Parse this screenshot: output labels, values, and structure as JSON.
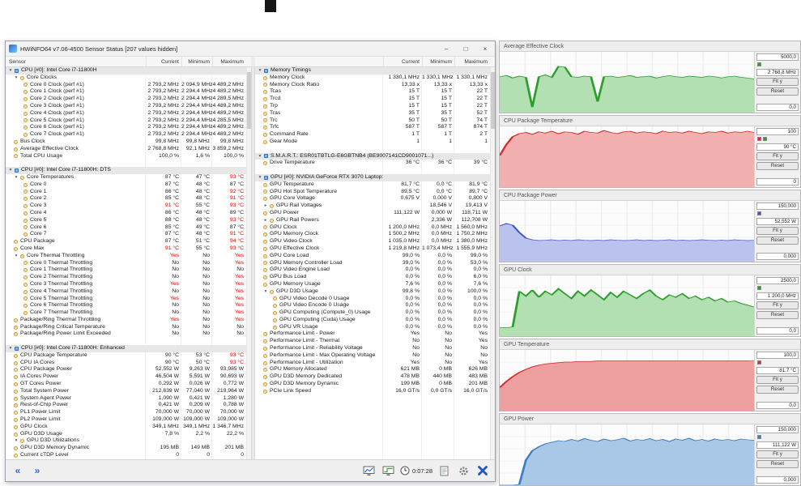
{
  "window": {
    "title": "HWiNFO64 v7.06-4500 Sensor Status [207 values hidden]",
    "controls": {
      "minimize": "–",
      "maximize": "□",
      "close": "×"
    }
  },
  "header": {
    "sensor": "Sensor",
    "current": "Current",
    "minimum": "Minimum",
    "maximum": "Maximum"
  },
  "toolbar": {
    "time": "0:07:28",
    "shrink_icon": "«",
    "expand_icon": "»"
  },
  "graph_buttons": {
    "fit": "Fit y",
    "reset": "Reset"
  },
  "left_rows": [
    {
      "t": "s",
      "l": "CPU [#0]: Intel Core i7-11800H"
    },
    {
      "t": "g",
      "i": 1,
      "l": "Core Clocks"
    },
    {
      "t": "i",
      "i": 2,
      "l": "Core 0 Clock (perf #1)",
      "c": "2 793,2 MHz",
      "m": "2 094,9 MHz",
      "x": "4 489,2 MHz"
    },
    {
      "t": "i",
      "i": 2,
      "l": "Core 1 Clock (perf #1)",
      "c": "2 793,2 MHz",
      "m": "2 294,4 MHz",
      "x": "4 489,2 MHz"
    },
    {
      "t": "i",
      "i": 2,
      "l": "Core 2 Clock (perf #1)",
      "c": "2 793,2 MHz",
      "m": "2 294,4 MHz",
      "x": "4 289,5 MHz"
    },
    {
      "t": "i",
      "i": 2,
      "l": "Core 3 Clock (perf #1)",
      "c": "2 793,2 MHz",
      "m": "2 294,4 MHz",
      "x": "4 489,2 MHz"
    },
    {
      "t": "i",
      "i": 2,
      "l": "Core 4 Clock (perf #1)",
      "c": "2 793,2 MHz",
      "m": "2 294,4 MHz",
      "x": "4 489,2 MHz"
    },
    {
      "t": "i",
      "i": 2,
      "l": "Core 5 Clock (perf #1)",
      "c": "2 793,2 MHz",
      "m": "2 294,4 MHz",
      "x": "4 285,5 MHz"
    },
    {
      "t": "i",
      "i": 2,
      "l": "Core 6 Clock (perf #1)",
      "c": "2 793,2 MHz",
      "m": "2 294,4 MHz",
      "x": "4 489,2 MHz"
    },
    {
      "t": "i",
      "i": 2,
      "l": "Core 7 Clock (perf #1)",
      "c": "2 793,2 MHz",
      "m": "2 294,4 MHz",
      "x": "4 489,2 MHz"
    },
    {
      "t": "i",
      "i": 1,
      "l": "Bus Clock",
      "c": "99,8 MHz",
      "m": "99,8 MHz",
      "x": "99,8 MHz"
    },
    {
      "t": "i",
      "i": 1,
      "l": "Average Effective Clock",
      "c": "2 768,8 MHz",
      "m": "92,1 MHz",
      "x": "3 859,2 MHz"
    },
    {
      "t": "i",
      "i": 1,
      "l": "Total CPU Usage",
      "c": "100,0 %",
      "m": "1,6 %",
      "x": "100,0 %"
    },
    {
      "t": "sp"
    },
    {
      "t": "s",
      "l": "CPU [#0]: Intel Core i7-11800H: DTS"
    },
    {
      "t": "g",
      "i": 1,
      "l": "Core Temperatures",
      "c": "87 °C",
      "m": "47 °C",
      "x": "93 °C",
      "r": "x"
    },
    {
      "t": "i",
      "i": 2,
      "l": "Core 0",
      "c": "87 °C",
      "m": "48 °C",
      "x": "87 °C"
    },
    {
      "t": "i",
      "i": 2,
      "l": "Core 1",
      "c": "86 °C",
      "m": "48 °C",
      "x": "92 °C",
      "r": "x"
    },
    {
      "t": "i",
      "i": 2,
      "l": "Core 2",
      "c": "85 °C",
      "m": "48 °C",
      "x": "91 °C",
      "r": "x"
    },
    {
      "t": "i",
      "i": 2,
      "l": "Core 3",
      "c": "91 °C",
      "m": "55 °C",
      "x": "93 °C",
      "r": "cx"
    },
    {
      "t": "i",
      "i": 2,
      "l": "Core 4",
      "c": "86 °C",
      "m": "48 °C",
      "x": "89 °C"
    },
    {
      "t": "i",
      "i": 2,
      "l": "Core 5",
      "c": "88 °C",
      "m": "48 °C",
      "x": "93 °C",
      "r": "x"
    },
    {
      "t": "i",
      "i": 2,
      "l": "Core 6",
      "c": "85 °C",
      "m": "49 °C",
      "x": "87 °C"
    },
    {
      "t": "i",
      "i": 2,
      "l": "Core 7",
      "c": "87 °C",
      "m": "48 °C",
      "x": "91 °C",
      "r": "x"
    },
    {
      "t": "i",
      "i": 1,
      "l": "CPU Package",
      "c": "87 °C",
      "m": "51 °C",
      "x": "94 °C",
      "r": "x"
    },
    {
      "t": "i",
      "i": 1,
      "l": "Core Max",
      "c": "91 °C",
      "m": "55 °C",
      "x": "93 °C",
      "r": "cx"
    },
    {
      "t": "g",
      "i": 1,
      "l": "Core Thermal Throttling",
      "c": "Yes",
      "m": "No",
      "x": "Yes",
      "r": "cx"
    },
    {
      "t": "i",
      "i": 2,
      "l": "Core 0 Thermal Throttling",
      "c": "No",
      "m": "No",
      "x": "Yes",
      "r": "x"
    },
    {
      "t": "i",
      "i": 2,
      "l": "Core 1 Thermal Throttling",
      "c": "No",
      "m": "No",
      "x": "No"
    },
    {
      "t": "i",
      "i": 2,
      "l": "Core 2 Thermal Throttling",
      "c": "No",
      "m": "No",
      "x": "Yes",
      "r": "x"
    },
    {
      "t": "i",
      "i": 2,
      "l": "Core 3 Thermal Throttling",
      "c": "Yes",
      "m": "No",
      "x": "Yes",
      "r": "cx"
    },
    {
      "t": "i",
      "i": 2,
      "l": "Core 4 Thermal Throttling",
      "c": "No",
      "m": "No",
      "x": "Yes",
      "r": "x"
    },
    {
      "t": "i",
      "i": 2,
      "l": "Core 5 Thermal Throttling",
      "c": "Yes",
      "m": "No",
      "x": "Yes",
      "r": "cx"
    },
    {
      "t": "i",
      "i": 2,
      "l": "Core 6 Thermal Throttling",
      "c": "No",
      "m": "No",
      "x": "Yes",
      "r": "x"
    },
    {
      "t": "i",
      "i": 2,
      "l": "Core 7 Thermal Throttling",
      "c": "No",
      "m": "No",
      "x": "Yes",
      "r": "x"
    },
    {
      "t": "i",
      "i": 1,
      "l": "Package/Ring Thermal Throttling",
      "c": "Yes",
      "m": "No",
      "x": "Yes",
      "r": "cx"
    },
    {
      "t": "i",
      "i": 1,
      "l": "Package/Ring Critical Temperature",
      "c": "No",
      "m": "No",
      "x": "No"
    },
    {
      "t": "i",
      "i": 1,
      "l": "Package/Ring Power Limit Exceeded",
      "c": "No",
      "m": "No",
      "x": "No"
    },
    {
      "t": "sp"
    },
    {
      "t": "s",
      "l": "CPU [#0]: Intel Core i7-11800H: Enhanced"
    },
    {
      "t": "i",
      "i": 1,
      "l": "CPU Package Temperature",
      "c": "90 °C",
      "m": "53 °C",
      "x": "93 °C",
      "r": "x"
    },
    {
      "t": "i",
      "i": 1,
      "l": "CPU IA Cores",
      "c": "90 °C",
      "m": "50 °C",
      "x": "93 °C",
      "r": "x"
    },
    {
      "t": "i",
      "i": 1,
      "l": "CPU Package Power",
      "c": "52,552 W",
      "m": "9,263 W",
      "x": "93,985 W"
    },
    {
      "t": "i",
      "i": 1,
      "l": "IA Cores Power",
      "c": "46,504 W",
      "m": "5,591 W",
      "x": "90,693 W"
    },
    {
      "t": "i",
      "i": 1,
      "l": "GT Cores Power",
      "c": "0,292 W",
      "m": "0,026 W",
      "x": "0,772 W"
    },
    {
      "t": "i",
      "i": 1,
      "l": "Total System Power",
      "c": "212,639 W",
      "m": "77,040 W",
      "x": "219,964 W"
    },
    {
      "t": "i",
      "i": 1,
      "l": "System Agent Power",
      "c": "1,090 W",
      "m": "0,421 W",
      "x": "1,280 W"
    },
    {
      "t": "i",
      "i": 1,
      "l": "Rest-of-Chip Power",
      "c": "0,421 W",
      "m": "0,209 W",
      "x": "0,788 W"
    },
    {
      "t": "i",
      "i": 1,
      "l": "PL1 Power Limit",
      "c": "70,000 W",
      "m": "70,000 W",
      "x": "70,000 W"
    },
    {
      "t": "i",
      "i": 1,
      "l": "PL2 Power Limit",
      "c": "109,000 W",
      "m": "109,000 W",
      "x": "109,000 W"
    },
    {
      "t": "i",
      "i": 1,
      "l": "GPU Clock",
      "c": "349,1 MHz",
      "m": "349,1 MHz",
      "x": "1 346,7 MHz"
    },
    {
      "t": "i",
      "i": 1,
      "l": "GPU D3D Usage",
      "c": "7,8 %",
      "m": "2,2 %",
      "x": "22,2 %"
    },
    {
      "t": "g",
      "i": 1,
      "l": "GPU D3D Utilizations"
    },
    {
      "t": "i",
      "i": 1,
      "l": "GPU D3D Memory Dynamic",
      "c": "195 MB",
      "m": "149 MB",
      "x": "201 MB"
    },
    {
      "t": "i",
      "i": 1,
      "l": "Current cTDP Level",
      "c": "0",
      "m": "0",
      "x": "0"
    }
  ],
  "mid_rows": [
    {
      "t": "s",
      "l": "Memory Timings"
    },
    {
      "t": "i",
      "i": 1,
      "l": "Memory Clock",
      "c": "1 330,1 MHz",
      "m": "1 330,1 MHz",
      "x": "1 330,1 MHz"
    },
    {
      "t": "i",
      "i": 1,
      "l": "Memory Clock Ratio",
      "c": "13,33 x",
      "m": "13,33 x",
      "x": "13,33 x"
    },
    {
      "t": "i",
      "i": 1,
      "l": "Tcas",
      "c": "15 T",
      "m": "15 T",
      "x": "22 T"
    },
    {
      "t": "i",
      "i": 1,
      "l": "Trcd",
      "c": "15 T",
      "m": "15 T",
      "x": "22 T"
    },
    {
      "t": "i",
      "i": 1,
      "l": "Trp",
      "c": "15 T",
      "m": "15 T",
      "x": "22 T"
    },
    {
      "t": "i",
      "i": 1,
      "l": "Tras",
      "c": "35 T",
      "m": "35 T",
      "x": "52 T"
    },
    {
      "t": "i",
      "i": 1,
      "l": "Trc",
      "c": "50 T",
      "m": "50 T",
      "x": "74 T"
    },
    {
      "t": "i",
      "i": 1,
      "l": "Trfc",
      "c": "587 T",
      "m": "587 T",
      "x": "874 T"
    },
    {
      "t": "i",
      "i": 1,
      "l": "Command Rate",
      "c": "1 T",
      "m": "1 T",
      "x": "2 T"
    },
    {
      "t": "i",
      "i": 1,
      "l": "Gear Mode",
      "c": "1",
      "m": "1",
      "x": "1"
    },
    {
      "t": "sp"
    },
    {
      "t": "s",
      "l": "S.M.A.R.T.: ESR01TBTLG-E6GBTNB4 (BE9007141CD9001071...)"
    },
    {
      "t": "i",
      "i": 1,
      "l": "Drive Temperature",
      "c": "36 °C",
      "m": "36 °C",
      "x": "39 °C"
    },
    {
      "t": "sp"
    },
    {
      "t": "s",
      "l": "GPU [#0]: NVIDIA GeForce RTX 3070 Laptop:"
    },
    {
      "t": "i",
      "i": 1,
      "l": "GPU Temperature",
      "c": "81,7 °C",
      "m": "0,0 °C",
      "x": "81,9 °C"
    },
    {
      "t": "i",
      "i": 1,
      "l": "GPU Hot Spot Temperature",
      "c": "89,5 °C",
      "m": "0,0 °C",
      "x": "89,7 °C"
    },
    {
      "t": "i",
      "i": 1,
      "l": "GPU Core Voltage",
      "c": "0,675 V",
      "m": "0,000 V",
      "x": "0,800 V"
    },
    {
      "t": "G",
      "i": 1,
      "l": "GPU Rail Voltages",
      "c": "",
      "m": "18,546 V",
      "x": "19,413 V"
    },
    {
      "t": "i",
      "i": 1,
      "l": "GPU Power",
      "c": "111,122 W",
      "m": "0,000 W",
      "x": "118,711 W"
    },
    {
      "t": "G",
      "i": 1,
      "l": "GPU Rail Powers",
      "c": "",
      "m": "2,336 W",
      "x": "112,708 W"
    },
    {
      "t": "i",
      "i": 1,
      "l": "GPU Clock",
      "c": "1 200,0 MHz",
      "m": "0,0 MHz",
      "x": "1 560,0 MHz"
    },
    {
      "t": "i",
      "i": 1,
      "l": "GPU Memory Clock",
      "c": "1 500,2 MHz",
      "m": "0,0 MHz",
      "x": "1 750,2 MHz"
    },
    {
      "t": "i",
      "i": 1,
      "l": "GPU Video Clock",
      "c": "1 035,0 MHz",
      "m": "0,0 MHz",
      "x": "1 380,0 MHz"
    },
    {
      "t": "i",
      "i": 1,
      "l": "GPU Effective Clock",
      "c": "1 219,8 MHz",
      "m": "1 073,4 MHz",
      "x": "1 555,9 MHz"
    },
    {
      "t": "i",
      "i": 1,
      "l": "GPU Core Load",
      "c": "99,0 %",
      "m": "0,0 %",
      "x": "99,0 %"
    },
    {
      "t": "i",
      "i": 1,
      "l": "GPU Memory Controller Load",
      "c": "39,0 %",
      "m": "0,0 %",
      "x": "53,0 %"
    },
    {
      "t": "i",
      "i": 1,
      "l": "GPU Video Engine Load",
      "c": "0,0 %",
      "m": "0,0 %",
      "x": "0,0 %"
    },
    {
      "t": "i",
      "i": 1,
      "l": "GPU Bus Load",
      "c": "0,0 %",
      "m": "0,0 %",
      "x": "6,0 %"
    },
    {
      "t": "i",
      "i": 1,
      "l": "GPU Memory Usage",
      "c": "7,6 %",
      "m": "0,0 %",
      "x": "7,6 %"
    },
    {
      "t": "g",
      "i": 1,
      "l": "GPU D3D Usage",
      "c": "99,8 %",
      "m": "0,0 %",
      "x": "100,0 %"
    },
    {
      "t": "i",
      "i": 2,
      "l": "GPU Video Decode 0 Usage",
      "c": "0,0 %",
      "m": "0,0 %",
      "x": "0,0 %"
    },
    {
      "t": "i",
      "i": 2,
      "l": "GPU Video Encode 0 Usage",
      "c": "0,0 %",
      "m": "0,0 %",
      "x": "0,0 %"
    },
    {
      "t": "i",
      "i": 2,
      "l": "GPU Computing (Compute_0) Usage",
      "c": "0,0 %",
      "m": "0,0 %",
      "x": "0,0 %"
    },
    {
      "t": "i",
      "i": 2,
      "l": "GPU Computing (Cuda) Usage",
      "c": "0,0 %",
      "m": "0,0 %",
      "x": "0,0 %"
    },
    {
      "t": "i",
      "i": 2,
      "l": "GPU VR Usage",
      "c": "0,0 %",
      "m": "0,0 %",
      "x": "0,0 %"
    },
    {
      "t": "i",
      "i": 1,
      "l": "Performance Limit - Power",
      "c": "Yes",
      "m": "No",
      "x": "Yes"
    },
    {
      "t": "i",
      "i": 1,
      "l": "Performance Limit - Thermal",
      "c": "No",
      "m": "No",
      "x": "Yes"
    },
    {
      "t": "i",
      "i": 1,
      "l": "Performance Limit - Reliability Voltage",
      "c": "No",
      "m": "No",
      "x": "No"
    },
    {
      "t": "i",
      "i": 1,
      "l": "Performance Limit - Max Operating Voltage",
      "c": "No",
      "m": "No",
      "x": "No"
    },
    {
      "t": "i",
      "i": 1,
      "l": "Performance Limit - Utilization",
      "c": "Yes",
      "m": "No",
      "x": "Yes"
    },
    {
      "t": "i",
      "i": 1,
      "l": "GPU Memory Allocated",
      "c": "621 MB",
      "m": "0 MB",
      "x": "626 MB"
    },
    {
      "t": "i",
      "i": 1,
      "l": "GPU D3D Memory Dedicated",
      "c": "478 MB",
      "m": "440 MB",
      "x": "483 MB"
    },
    {
      "t": "i",
      "i": 1,
      "l": "GPU D3D Memory Dynamic",
      "c": "199 MB",
      "m": "0 MB",
      "x": "201 MB"
    },
    {
      "t": "i",
      "i": 1,
      "l": "PCIe Link Speed",
      "c": "16,0 GT/s",
      "m": "0,0 GT/s",
      "x": "16,0 GT/s"
    }
  ],
  "graphs": [
    {
      "title": "Average Effective Clock",
      "ymax": "5000,0",
      "ymin": "0,0",
      "value": "2 768,8 MHz",
      "color": "#2e9e2e",
      "fill": "#b3e0b3",
      "range": 5000,
      "legend": [
        "#2e9e2e"
      ],
      "points": [
        2950,
        3050,
        2850,
        3000,
        2900,
        450,
        2950,
        3100,
        2900,
        3800,
        3750,
        2950,
        2900,
        3000,
        2950,
        900,
        2950,
        3000,
        2900,
        2950,
        3050,
        2900,
        2950,
        3000,
        2850,
        2950,
        3050,
        2950,
        2900,
        3000,
        2950,
        2900,
        3000,
        2950,
        2850,
        2950,
        3000,
        2900,
        2850,
        2769
      ]
    },
    {
      "title": "CPU Package Temperature",
      "ymax": "100",
      "ymin": "0",
      "value": "90 °C",
      "color": "#d03030",
      "fill": "#f2b0b0",
      "range": 100,
      "legend": [
        "#d03030",
        "#2e9e2e"
      ],
      "points": [
        52,
        70,
        83,
        88,
        90,
        87,
        91,
        89,
        92,
        88,
        91,
        90,
        87,
        92,
        90,
        89,
        93,
        90,
        88,
        91,
        92,
        89,
        91,
        90,
        88,
        92,
        90,
        91,
        89,
        92,
        90,
        88,
        91,
        90,
        92,
        89,
        91,
        90,
        92,
        90
      ]
    },
    {
      "title": "CPU Package Power",
      "ymax": "150,000",
      "ymin": "0,000",
      "value": "52,552 W",
      "color": "#4656c8",
      "fill": "#b9c3ee",
      "range": 150,
      "legend": [
        "#4656c8"
      ],
      "points": [
        88,
        94,
        90,
        72,
        58,
        54,
        52,
        53,
        54,
        52,
        53,
        52,
        54,
        53,
        52,
        53,
        52,
        54,
        53,
        52,
        53,
        54,
        52,
        53,
        52,
        53,
        54,
        52,
        53,
        52,
        53,
        54,
        53,
        52,
        53,
        52,
        54,
        53,
        52,
        52.6
      ]
    },
    {
      "title": "GPU Clock",
      "ymax": "2500,0",
      "ymin": "0,0",
      "value": "1 200,0 MHz",
      "color": "#2e9e2e",
      "fill": "#b3e0b3",
      "range": 2500,
      "legend": [
        "#2e9e2e"
      ],
      "points": [
        360,
        350,
        380,
        1850,
        1650,
        1900,
        1600,
        1850,
        1700,
        1950,
        1750,
        1550,
        1850,
        1650,
        1900,
        1700,
        1500,
        1800,
        1600,
        1850,
        1700,
        1550,
        1750,
        1900,
        1650,
        1500,
        1700,
        1600,
        1750,
        1550,
        1650,
        1500,
        1600,
        1450,
        1550,
        1400,
        1450,
        1350,
        1280,
        1200
      ]
    },
    {
      "title": "GPU Temperature",
      "ymax": "100,0",
      "ymin": "0,0",
      "value": "81,7 °C",
      "color": "#d03030",
      "fill": "#ee9f9f",
      "range": 100,
      "legend": [
        "#d03030"
      ],
      "points": [
        38,
        48,
        56,
        63,
        68,
        72,
        75,
        77,
        78,
        79,
        80,
        80,
        81,
        81,
        81,
        82,
        82,
        82,
        82,
        82,
        82,
        82,
        82,
        82,
        82,
        82,
        82,
        82,
        82,
        82,
        82,
        82,
        82,
        82,
        82,
        82,
        82,
        82,
        82,
        81.7
      ]
    },
    {
      "title": "GPU Power",
      "ymax": "150,000",
      "ymin": "0,000",
      "value": "111,122 W",
      "color": "#3f7fbf",
      "fill": "#a9c7e6",
      "range": 150,
      "legend": [
        "#3f7fbf"
      ],
      "points": [
        0,
        0,
        0,
        2,
        62,
        85,
        95,
        102,
        106,
        110,
        108,
        113,
        109,
        115,
        111,
        108,
        114,
        110,
        112,
        116,
        109,
        113,
        111,
        115,
        110,
        113,
        108,
        114,
        111,
        116,
        110,
        113,
        109,
        114,
        111,
        113,
        110,
        114,
        112,
        111
      ]
    }
  ]
}
